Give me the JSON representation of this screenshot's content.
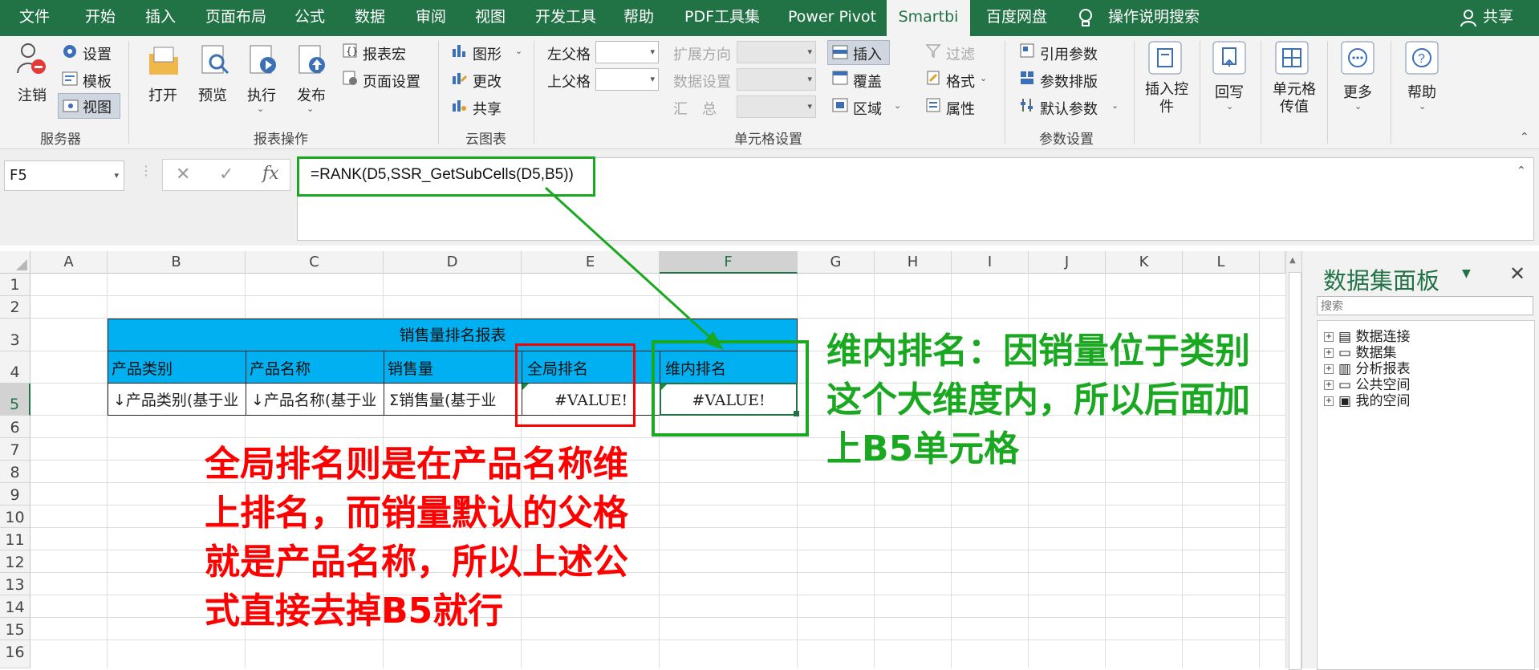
{
  "tabs": [
    "文件",
    "开始",
    "插入",
    "页面布局",
    "公式",
    "数据",
    "审阅",
    "视图",
    "开发工具",
    "帮助",
    "PDF工具集",
    "Power Pivot",
    "Smartbi",
    "百度网盘",
    "操作说明搜索"
  ],
  "active_tab": "Smartbi",
  "share_label": "共享",
  "ribbon": {
    "server": {
      "logout": "注销",
      "settings": "设置",
      "template": "模板",
      "view": "视图",
      "group_label": "服务器"
    },
    "report_ops": {
      "open": "打开",
      "preview": "预览",
      "execute": "执行",
      "publish": "发布",
      "report_macro": "报表宏",
      "page_setup": "页面设置",
      "group_label": "报表操作"
    },
    "cloud_chart": {
      "chart": "图形",
      "modify": "更改",
      "share": "共享",
      "group_label": "云图表"
    },
    "cell_settings": {
      "left_parent": "左父格",
      "top_parent": "上父格",
      "expand_dir": "扩展方向",
      "data_setting": "数据设置",
      "summary": "汇　总",
      "insert": "插入",
      "overwrite": "覆盖",
      "region": "区域",
      "filter": "过滤",
      "format": "格式",
      "property": "属性",
      "group_label": "单元格设置"
    },
    "param_settings": {
      "ref_param": "引用参数",
      "param_layout": "参数排版",
      "default_param": "默认参数",
      "group_label": "参数设置"
    },
    "insert_ctrl": "插入控件",
    "writeback": "回写",
    "cell_transfer": "单元格传值",
    "more": "更多",
    "help": "帮助"
  },
  "formula_bar": {
    "name_box": "F5",
    "cancel_icon": "✕",
    "enter_icon": "✓",
    "fx": "fx",
    "formula": "=RANK(D5,SSR_GetSubCells(D5,B5))"
  },
  "columns": [
    "A",
    "B",
    "C",
    "D",
    "E",
    "F",
    "G",
    "H",
    "I",
    "J",
    "K",
    "L"
  ],
  "rows": [
    "1",
    "2",
    "3",
    "4",
    "5",
    "6",
    "7",
    "8",
    "9",
    "10",
    "11",
    "12",
    "13",
    "14",
    "15",
    "16"
  ],
  "report": {
    "title": "销售量排名报表",
    "headers": [
      "产品类别",
      "产品名称",
      "销售量",
      "全局排名",
      "维内排名"
    ],
    "row5": [
      "↓产品类别(基于业",
      "↓产品名称(基于业",
      "Σ销售量(基于业",
      "#VALUE!",
      "#VALUE!"
    ]
  },
  "annotations": {
    "red_note": [
      "全局排名则是在产品名称维",
      "上排名，而销量默认的父格",
      "就是产品名称，所以上述公",
      "式直接去掉B5就行"
    ],
    "green_note": [
      "维内排名：因销量位于类别",
      "这个大维度内，所以后面加",
      "上B5单元格"
    ]
  },
  "panel": {
    "title": "数据集面板",
    "search_placeholder": "搜索",
    "items": [
      "数据连接",
      "数据集",
      "分析报表",
      "公共空间",
      "我的空间"
    ]
  },
  "colors": {
    "excel_green": "#217346",
    "report_blue": "#00b0f0",
    "note_red": "#ff0000",
    "note_green": "#1aa821"
  }
}
